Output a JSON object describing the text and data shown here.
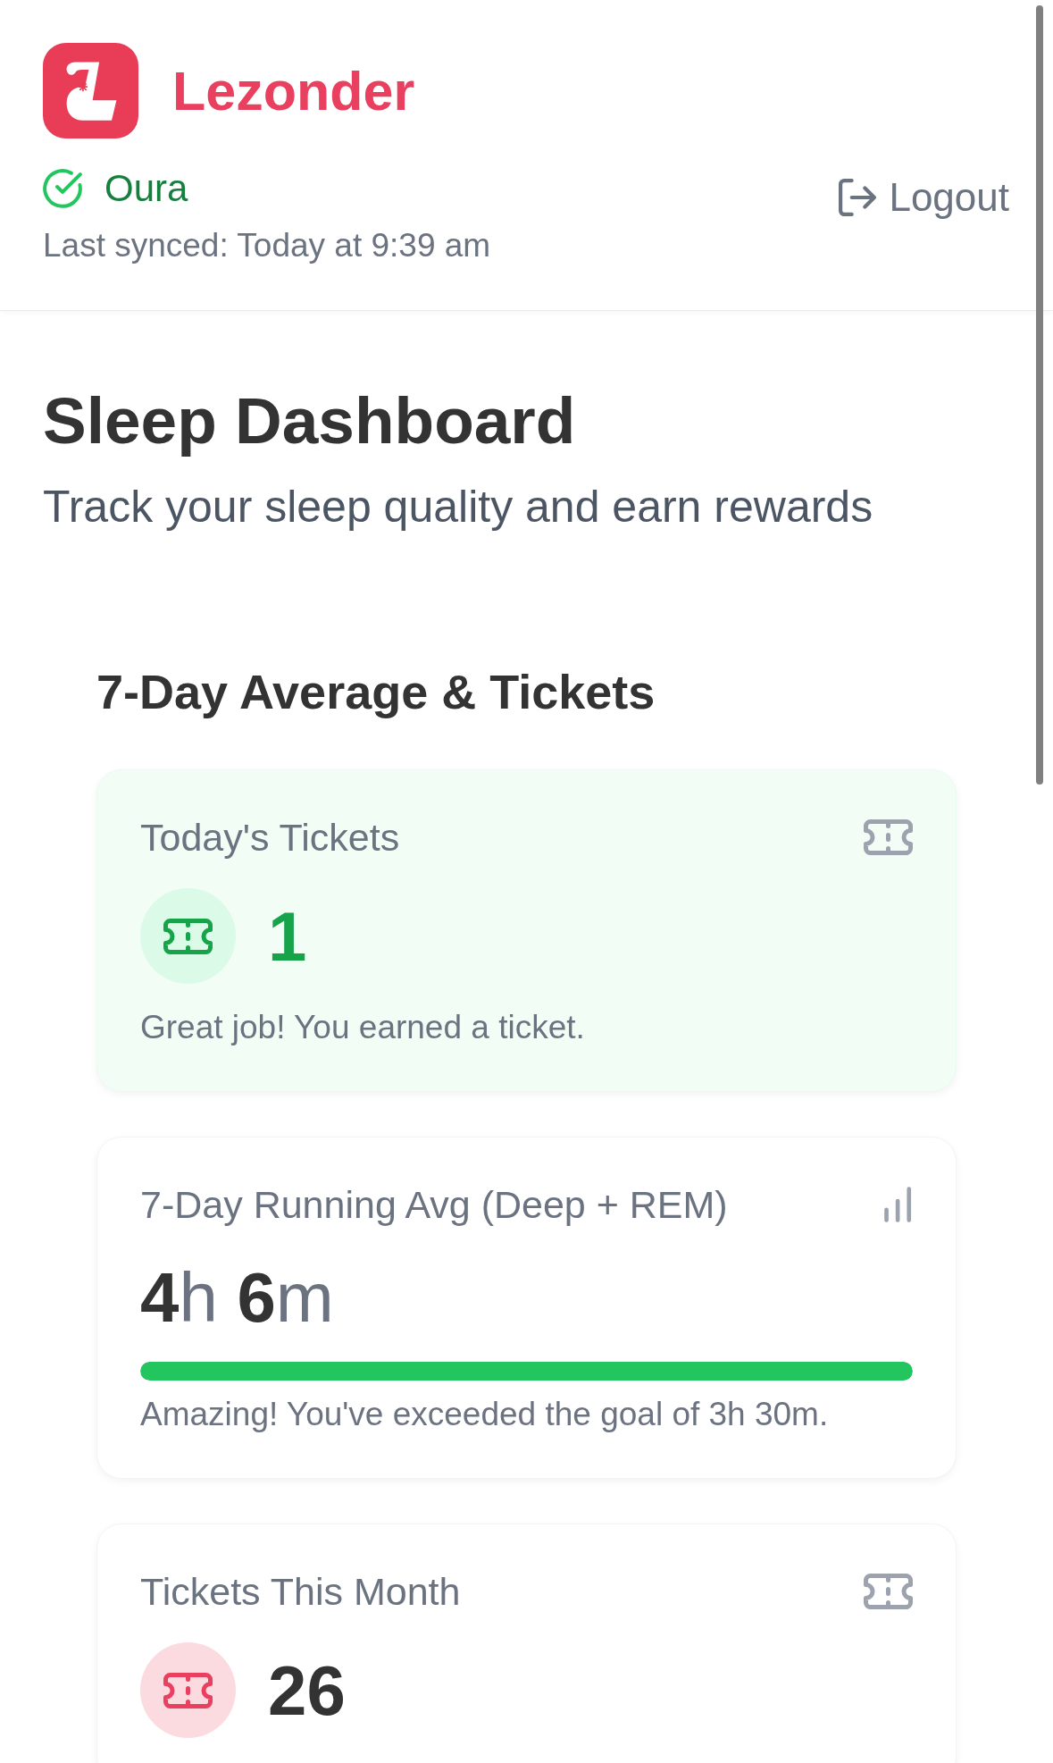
{
  "header": {
    "brand": {
      "name": "Lezonder"
    },
    "connection": {
      "provider": "Oura",
      "connected": true,
      "last_synced": "Last synced: Today at 9:39 am"
    },
    "logout": {
      "label": "Logout"
    }
  },
  "page": {
    "title": "Sleep Dashboard",
    "subtitle": "Track your sleep quality and earn rewards"
  },
  "section": {
    "title": "7-Day Average & Tickets",
    "cards": [
      {
        "kind": "tickets",
        "title": "Today's Tickets",
        "highlighted": true,
        "color": "#16a34a",
        "value": "1",
        "message": "Great job! You earned a ticket."
      },
      {
        "kind": "progress",
        "title": "7-Day Running Avg (Deep + REM)",
        "value": "**4**h **6**m",
        "level": 1,
        "message": "Amazing! You've exceeded the goal of 3h 30m."
      },
      {
        "kind": "tickets",
        "title": "Tickets This Month",
        "highlighted": false,
        "color": "#e8405e",
        "value": "26"
      }
    ]
  }
}
